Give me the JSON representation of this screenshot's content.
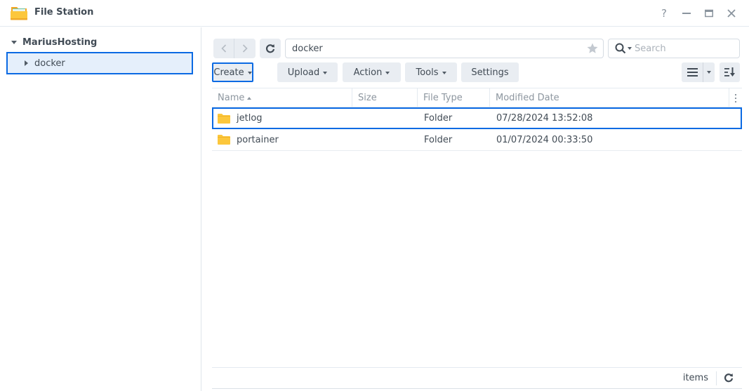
{
  "window": {
    "title": "File Station",
    "icon": "folder-app-icon",
    "controls": {
      "help": "?",
      "minimize": "minimize-icon",
      "maximize": "maximize-icon",
      "close": "close-icon"
    }
  },
  "sidebar": {
    "root": {
      "label": "MariusHosting",
      "expanded": true
    },
    "items": [
      {
        "label": "docker",
        "selected": true,
        "expanded": false
      }
    ]
  },
  "toolbar": {
    "path": "docker",
    "search_placeholder": "Search",
    "buttons": {
      "create": "Create",
      "upload": "Upload",
      "action": "Action",
      "tools": "Tools",
      "settings": "Settings"
    }
  },
  "grid": {
    "columns": {
      "name": "Name",
      "size": "Size",
      "type": "File Type",
      "date": "Modified Date"
    },
    "sort": {
      "column": "Name",
      "direction": "ascending"
    },
    "rows": [
      {
        "name": "jetlog",
        "size": "",
        "type": "Folder",
        "date": "07/28/2024 13:52:08",
        "selected": true
      },
      {
        "name": "portainer",
        "size": "",
        "type": "Folder",
        "date": "01/07/2024 00:33:50",
        "selected": false
      }
    ]
  },
  "status": {
    "items_label": "items"
  },
  "colors": {
    "accent": "#0b6ae3",
    "selection_bg": "#e5effb",
    "button_bg": "#e9edf2",
    "folder": "#fcc73c"
  }
}
